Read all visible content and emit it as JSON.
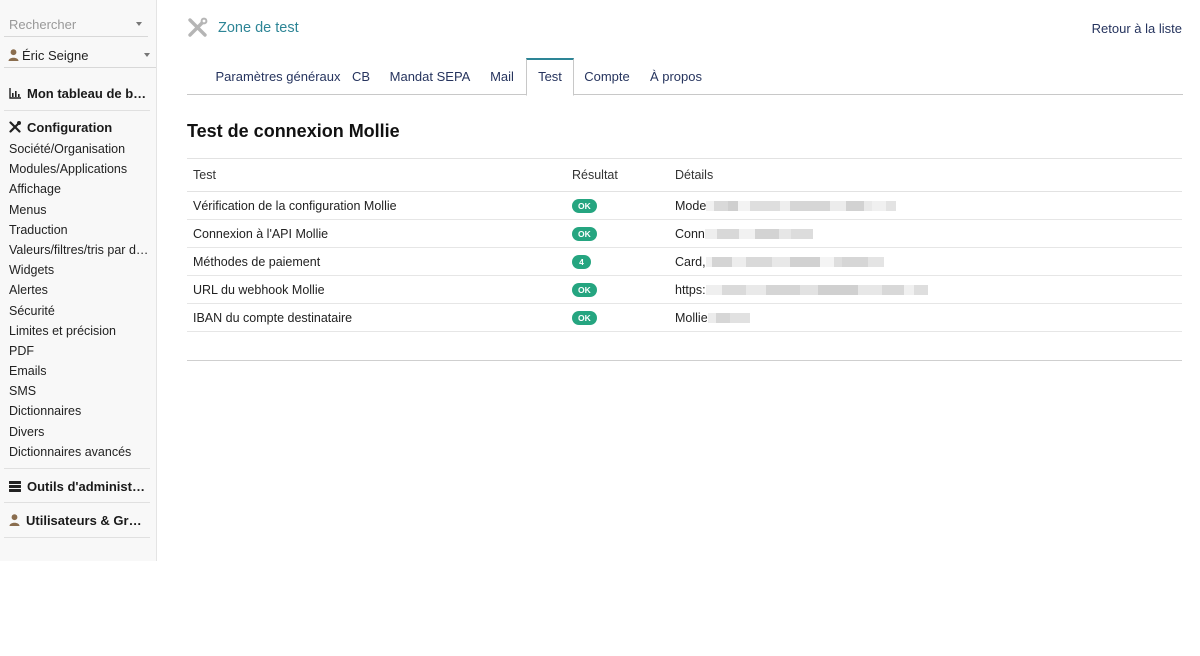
{
  "sidebar": {
    "search": {
      "placeholder": "Rechercher",
      "value": ""
    },
    "user": {
      "name": "Éric Seigne"
    },
    "dashboard": {
      "label": "Mon tableau de bord",
      "icon": "bar-chart-icon"
    },
    "configuration": {
      "label": "Configuration",
      "icon": "tools-icon",
      "items": [
        {
          "label": "Société/Organisation"
        },
        {
          "label": "Modules/Applications"
        },
        {
          "label": "Affichage"
        },
        {
          "label": "Menus"
        },
        {
          "label": "Traduction"
        },
        {
          "label": "Valeurs/filtres/tris par défaut"
        },
        {
          "label": "Widgets"
        },
        {
          "label": "Alertes"
        },
        {
          "label": "Sécurité"
        },
        {
          "label": "Limites et précision"
        },
        {
          "label": "PDF"
        },
        {
          "label": "Emails"
        },
        {
          "label": "SMS"
        },
        {
          "label": "Dictionnaires"
        },
        {
          "label": "Divers"
        },
        {
          "label": "Dictionnaires avancés"
        }
      ]
    },
    "admin_tools": {
      "label": "Outils d'administration",
      "icon": "server-icon"
    },
    "users_groups": {
      "label": "Utilisateurs & Groupes",
      "icon": "user-icon"
    }
  },
  "header": {
    "title": "Zone de test",
    "icon": "tools-icon",
    "back_link": "Retour à la liste"
  },
  "tabs": [
    {
      "label": "Paramètres généraux",
      "active": false
    },
    {
      "label": "CB",
      "active": false
    },
    {
      "label": "Mandat SEPA",
      "active": false
    },
    {
      "label": "Mail",
      "active": false
    },
    {
      "label": "Test",
      "active": true
    },
    {
      "label": "Compte",
      "active": false
    },
    {
      "label": "À propos",
      "active": false
    }
  ],
  "page": {
    "title": "Test de connexion Mollie"
  },
  "table": {
    "headers": {
      "test": "Test",
      "result": "Résultat",
      "details": "Détails"
    },
    "rows": [
      {
        "test": "Vérification de la configuration Mollie",
        "result": "OK",
        "details": "Mode"
      },
      {
        "test": "Connexion à l'API Mollie",
        "result": "OK",
        "details": "Conn"
      },
      {
        "test": "Méthodes de paiement",
        "result": "4",
        "details": "Card,"
      },
      {
        "test": "URL du webhook Mollie",
        "result": "OK",
        "details": "https:"
      },
      {
        "test": "IBAN du compte destinataire",
        "result": "OK",
        "details": "Mollie"
      }
    ]
  },
  "colors": {
    "accent": "#2d8596",
    "link": "#26345e",
    "badge_green": "#25a580"
  }
}
